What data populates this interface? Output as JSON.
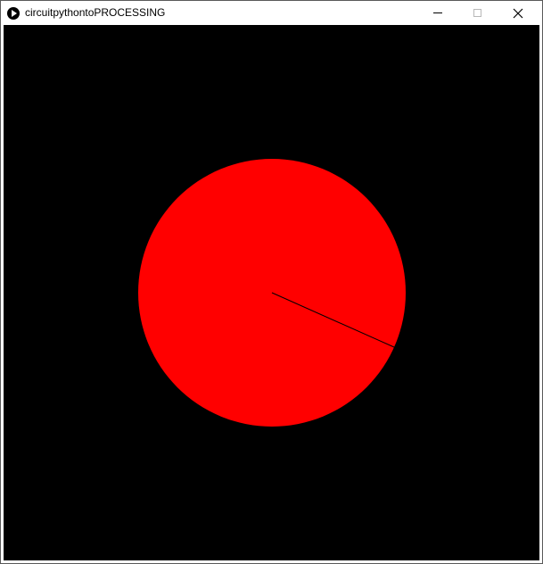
{
  "window": {
    "title": "circuitpythontoPROCESSING",
    "controls": {
      "minimize": "minimize-icon",
      "maximize": "maximize-icon",
      "close": "close-icon"
    }
  },
  "sketch": {
    "background_color": "#000000",
    "circle_fill": "#ff0000",
    "needle_color": "#000000",
    "needle_angle_degrees": 24
  }
}
